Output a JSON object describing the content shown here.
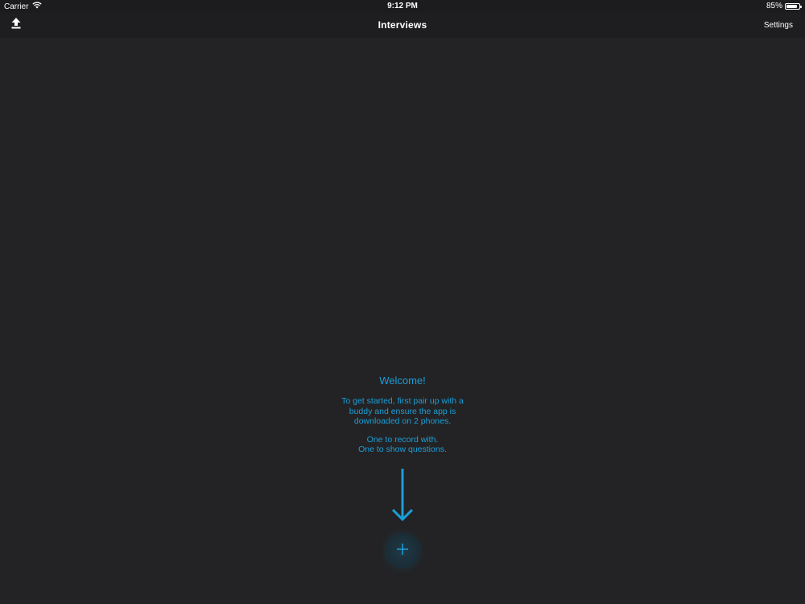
{
  "status_bar": {
    "carrier": "Carrier",
    "wifi_icon": "wifi-icon",
    "time": "9:12 PM",
    "battery_percent": "85%",
    "battery_level": 0.85
  },
  "nav": {
    "upload_icon": "upload-icon",
    "title": "Interviews",
    "settings_label": "Settings"
  },
  "welcome": {
    "heading": "Welcome!",
    "line1": "To get started, first pair up with a buddy and ensure the app is downloaded on 2 phones.",
    "line2": "One to record with.",
    "line3": "One to show questions."
  },
  "add_button": {
    "icon": "plus-icon"
  },
  "colors": {
    "background": "#232325",
    "accent": "#1a9fd8",
    "nav_background": "#1e1e20"
  }
}
